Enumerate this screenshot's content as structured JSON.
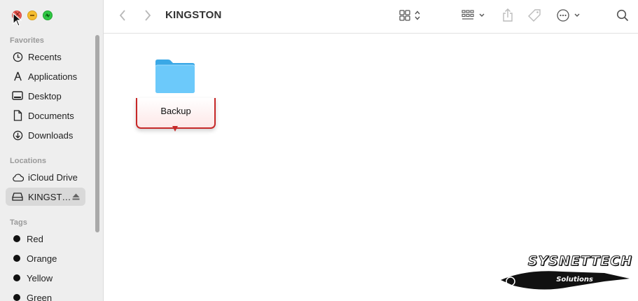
{
  "window": {
    "title": "KINGSTON"
  },
  "sidebar": {
    "sections": {
      "favorites": "Favorites",
      "locations": "Locations",
      "tags": "Tags"
    },
    "favorites": [
      {
        "label": "Recents",
        "icon": "clock-icon"
      },
      {
        "label": "Applications",
        "icon": "applications-icon"
      },
      {
        "label": "Desktop",
        "icon": "desktop-icon"
      },
      {
        "label": "Documents",
        "icon": "document-icon"
      },
      {
        "label": "Downloads",
        "icon": "download-icon"
      }
    ],
    "locations": [
      {
        "label": "iCloud Drive",
        "icon": "cloud-icon"
      },
      {
        "label": "KINGST…",
        "icon": "drive-icon",
        "selected": true
      }
    ],
    "tags": [
      {
        "label": "Red",
        "color": "#111111"
      },
      {
        "label": "Orange",
        "color": "#111111"
      },
      {
        "label": "Yellow",
        "color": "#111111"
      },
      {
        "label": "Green",
        "color": "#111111"
      }
    ]
  },
  "toolbar": {
    "icons": [
      "chevron-left-icon",
      "chevron-right-icon",
      "grid-view-icon",
      "group-icon",
      "share-icon",
      "tag-icon",
      "more-icon",
      "search-icon"
    ]
  },
  "content": {
    "items": [
      {
        "name": "Backup",
        "kind": "folder",
        "renaming": true
      }
    ]
  },
  "watermark": {
    "line1": "SYSNETTECH",
    "line2": "Solutions"
  },
  "colors": {
    "folder": "#5ec3f7",
    "accent_red": "#c62828",
    "sidebar_bg": "#eeeeee"
  }
}
